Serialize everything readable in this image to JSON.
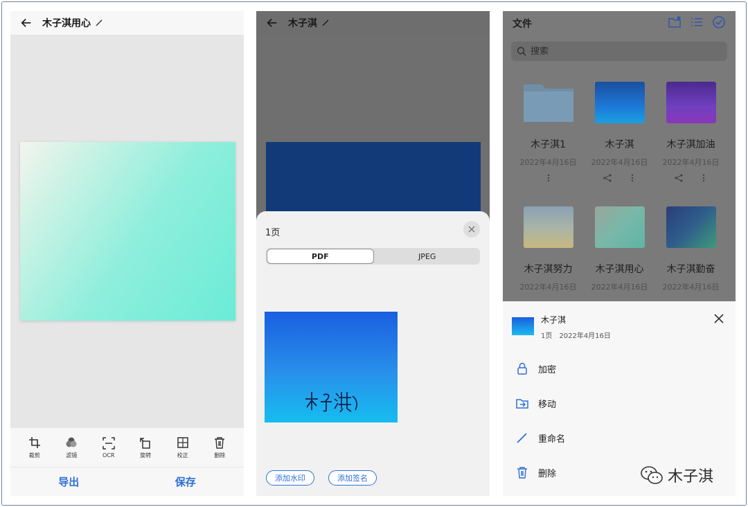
{
  "panel1": {
    "title": "木子淇用心",
    "tools": [
      {
        "label": "裁剪",
        "icon": "crop-icon"
      },
      {
        "label": "滤镜",
        "icon": "filter-icon"
      },
      {
        "label": "OCR",
        "icon": "ocr-icon"
      },
      {
        "label": "旋转",
        "icon": "rotate-icon"
      },
      {
        "label": "校正",
        "icon": "correct-icon"
      },
      {
        "label": "删除",
        "icon": "trash-icon"
      }
    ],
    "export_label": "导出",
    "save_label": "保存"
  },
  "panel2": {
    "title": "木子淇",
    "sheet_title": "1页",
    "format_options": [
      "PDF",
      "JPEG"
    ],
    "selected_format": "PDF",
    "add_watermark": "添加水印",
    "add_signature": "添加签名"
  },
  "panel3": {
    "title": "文件",
    "search_placeholder": "搜索",
    "files": [
      {
        "name": "木子淇1",
        "date": "2022年4月16日",
        "thumb": "folder"
      },
      {
        "name": "木子淇",
        "date": "2022年4月16日",
        "thumb": "#1d78d8"
      },
      {
        "name": "木子淇加油",
        "date": "2022年4月16日",
        "thumb": "#7040c0"
      },
      {
        "name": "木子淇努力",
        "date": "2022年4月16日",
        "thumb": "#b8c7b6"
      },
      {
        "name": "木子淇用心",
        "date": "2022年4月16日",
        "thumb": "#78b8a8"
      },
      {
        "name": "木子淇勤奋",
        "date": "2022年4月16日",
        "thumb": "#2f5e8a"
      }
    ],
    "detail": {
      "name": "木子淇",
      "pages": "1页",
      "date": "2022年4月16日"
    },
    "menu": [
      {
        "label": "加密",
        "icon": "lock-icon"
      },
      {
        "label": "移动",
        "icon": "move-folder-icon"
      },
      {
        "label": "重命名",
        "icon": "pencil-icon"
      },
      {
        "label": "删除",
        "icon": "trash-icon"
      }
    ]
  },
  "watermark": "木子淇",
  "colors": {
    "accent": "#2f6fd6"
  }
}
